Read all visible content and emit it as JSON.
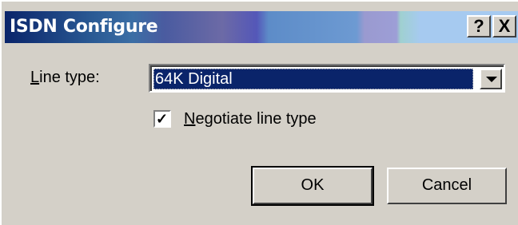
{
  "window": {
    "title": "ISDN Configure",
    "help_button": "?",
    "close_button": "X"
  },
  "line_type": {
    "label_accel": "L",
    "label_rest": "ine type:",
    "value": "64K Digital"
  },
  "negotiate": {
    "checked": true,
    "checkmark": "✓",
    "label_accel": "N",
    "label_rest": "egotiate line type"
  },
  "buttons": {
    "ok": "OK",
    "cancel": "Cancel"
  },
  "colors": {
    "dialog_bg": "#d4d0c8",
    "title_start": "#0a246a",
    "title_end": "#a6caf0",
    "selection": "#0a246a"
  }
}
